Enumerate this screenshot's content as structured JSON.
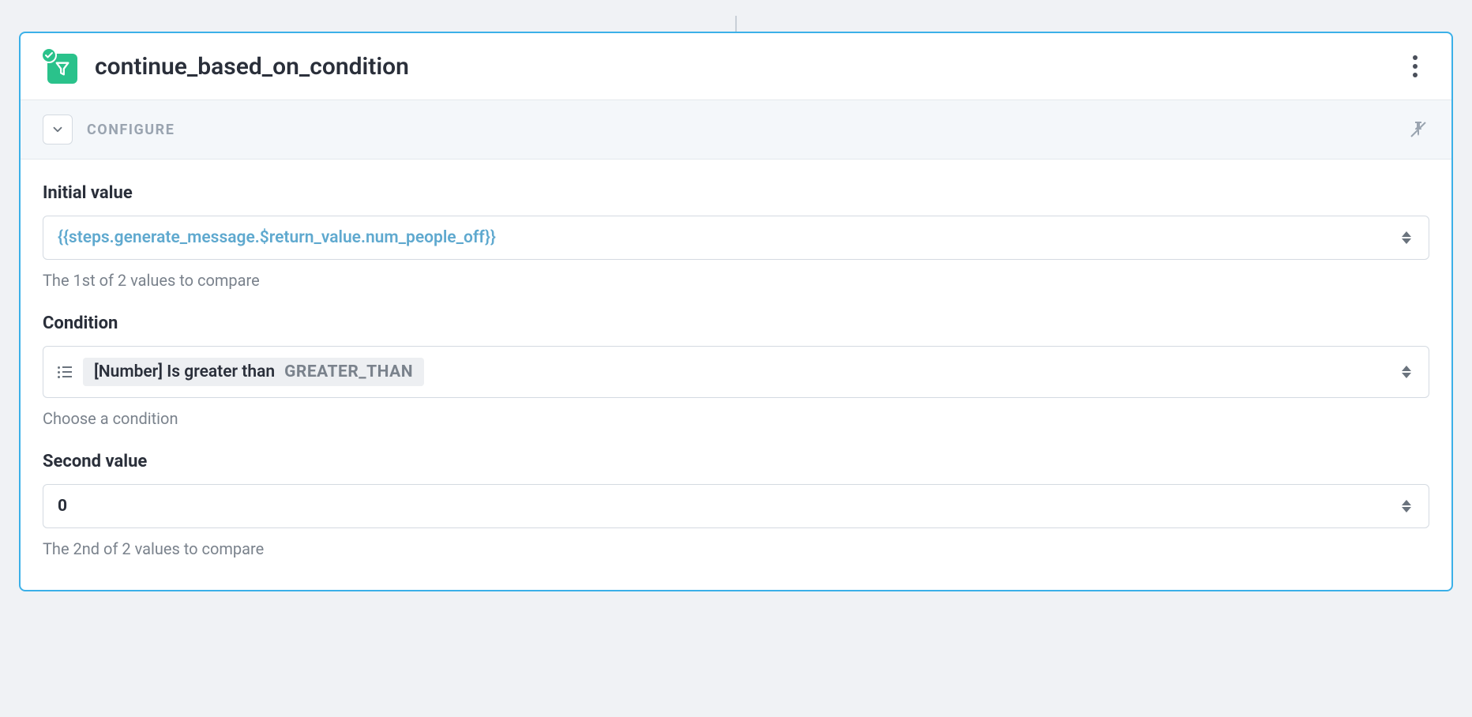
{
  "header": {
    "title": "continue_based_on_condition"
  },
  "configure": {
    "label": "CONFIGURE"
  },
  "fields": {
    "initial_value": {
      "label": "Initial value",
      "value": "{{steps.generate_message.$return_value.num_people_off}}",
      "help": "The 1st of 2 values to compare"
    },
    "condition": {
      "label": "Condition",
      "chip_primary": "[Number] Is greater than",
      "chip_secondary": "GREATER_THAN",
      "help": "Choose a condition"
    },
    "second_value": {
      "label": "Second value",
      "value": "0",
      "help": "The 2nd of 2 values to compare"
    }
  }
}
